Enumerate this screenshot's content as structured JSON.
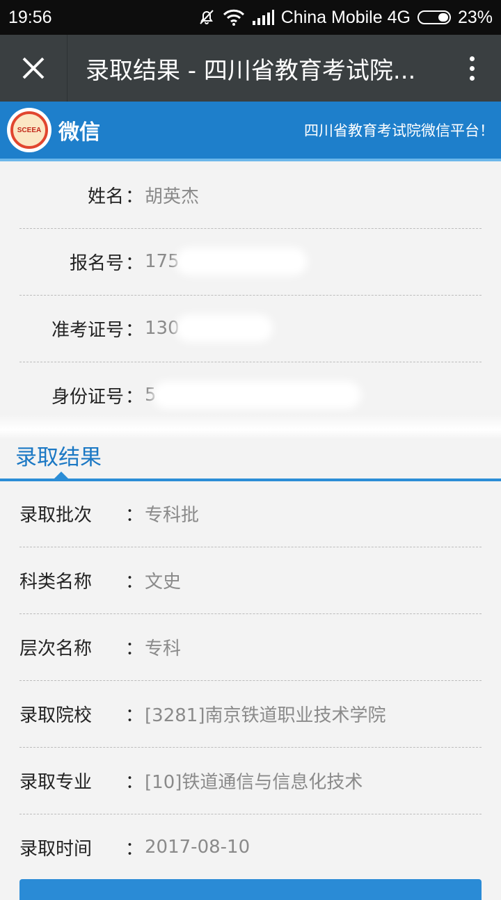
{
  "status": {
    "time": "19:56",
    "carrier": "China Mobile 4G",
    "battery": "23%",
    "icons": [
      "mute-bell-icon",
      "wifi-icon",
      "signal-icon",
      "battery-icon"
    ]
  },
  "topbar": {
    "title": "录取结果 - 四川省教育考试院...",
    "close_icon": "close-icon",
    "more_icon": "more-vertical-icon"
  },
  "brand": {
    "logo_text": "SCEEA",
    "wx_label": "微信",
    "slogan": "四川省教育考试院微信平台！"
  },
  "personal": [
    {
      "label": "姓名",
      "sep": "：",
      "value": "胡英杰"
    },
    {
      "label": "报名号",
      "sep": "：",
      "value": "175"
    },
    {
      "label": "准考证号",
      "sep": "：",
      "value": "130"
    },
    {
      "label": "身份证号",
      "sep": "：",
      "value": "5"
    }
  ],
  "result_section": {
    "title": "录取结果"
  },
  "results": [
    {
      "label": "录取批次",
      "sep": "：",
      "value": "专科批"
    },
    {
      "label": "科类名称",
      "sep": "：",
      "value": "文史"
    },
    {
      "label": "层次名称",
      "sep": "：",
      "value": "专科"
    },
    {
      "label": "录取院校",
      "sep": "：",
      "value": "[3281]南京铁道职业技术学院"
    },
    {
      "label": "录取专业",
      "sep": "：",
      "value": "[10]铁道通信与信息化技术"
    },
    {
      "label": "录取时间",
      "sep": "：",
      "value": "2017-08-10"
    }
  ],
  "colors": {
    "brand_blue": "#1e7fcb",
    "accent_blue": "#2b8dd6",
    "topbar": "#3a3f41"
  }
}
